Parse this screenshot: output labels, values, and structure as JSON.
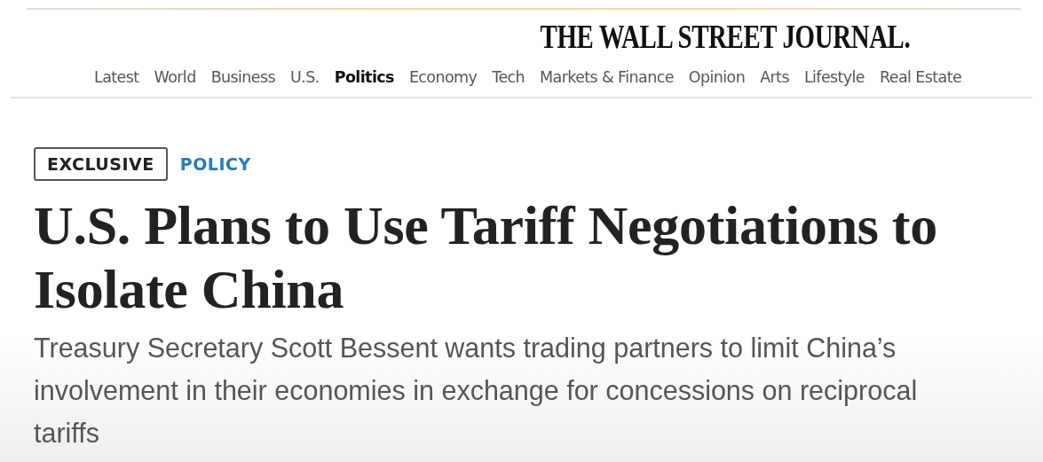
{
  "masthead": {
    "logo": "THE WALL STREET JOURNAL."
  },
  "nav": {
    "items": [
      {
        "label": "Latest",
        "selected": false
      },
      {
        "label": "World",
        "selected": false
      },
      {
        "label": "Business",
        "selected": false
      },
      {
        "label": "U.S.",
        "selected": false
      },
      {
        "label": "Politics",
        "selected": true
      },
      {
        "label": "Economy",
        "selected": false
      },
      {
        "label": "Tech",
        "selected": false
      },
      {
        "label": "Markets & Finance",
        "selected": false
      },
      {
        "label": "Opinion",
        "selected": false
      },
      {
        "label": "Arts",
        "selected": false
      },
      {
        "label": "Lifestyle",
        "selected": false
      },
      {
        "label": "Real Estate",
        "selected": false
      }
    ]
  },
  "article": {
    "badge": "EXCLUSIVE",
    "section": "POLICY",
    "headline": "U.S. Plans to Use Tariff Negotiations to Isolate China",
    "dek": "Treasury Secretary Scott Bessent wants trading partners to limit China’s involvement in their economies in exchange for concessions on reciprocal tariffs"
  }
}
